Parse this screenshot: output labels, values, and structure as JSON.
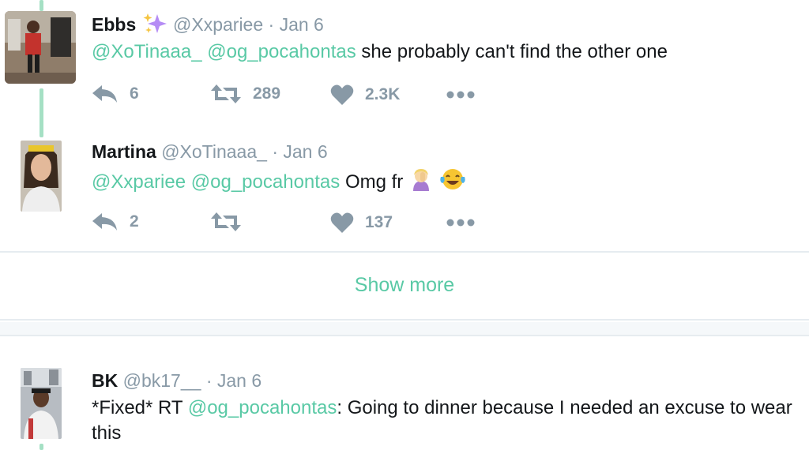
{
  "colors": {
    "accent": "#59c9a5",
    "meta": "#8899a6",
    "thread_line": "#a5e0c4"
  },
  "tweets": [
    {
      "name": "Ebbs",
      "name_emoji": "sparkles-icon",
      "handle": "@Xxpariee",
      "date": "· Jan 6",
      "mentions": [
        "@XoTinaaa_",
        "@og_pocahontas"
      ],
      "text": "she probably can't find the other one",
      "replies": "6",
      "retweets": "289",
      "likes": "2.3K"
    },
    {
      "name": "Martina",
      "handle": "@XoTinaaa_",
      "date": "· Jan 6",
      "mentions": [
        "@Xxpariee",
        "@og_pocahontas"
      ],
      "text": "Omg fr",
      "emojis": [
        "facepalm-emoji",
        "tears-of-joy-emoji"
      ],
      "replies": "2",
      "retweets": "",
      "likes": "137"
    },
    {
      "name": "BK",
      "handle": "@bk17__",
      "date": "· Jan 6",
      "prefix": "*Fixed* RT",
      "mentions": [
        "@og_pocahontas"
      ],
      "text": ": Going to dinner because I needed an excuse to wear this"
    }
  ],
  "show_more_label": "Show more"
}
